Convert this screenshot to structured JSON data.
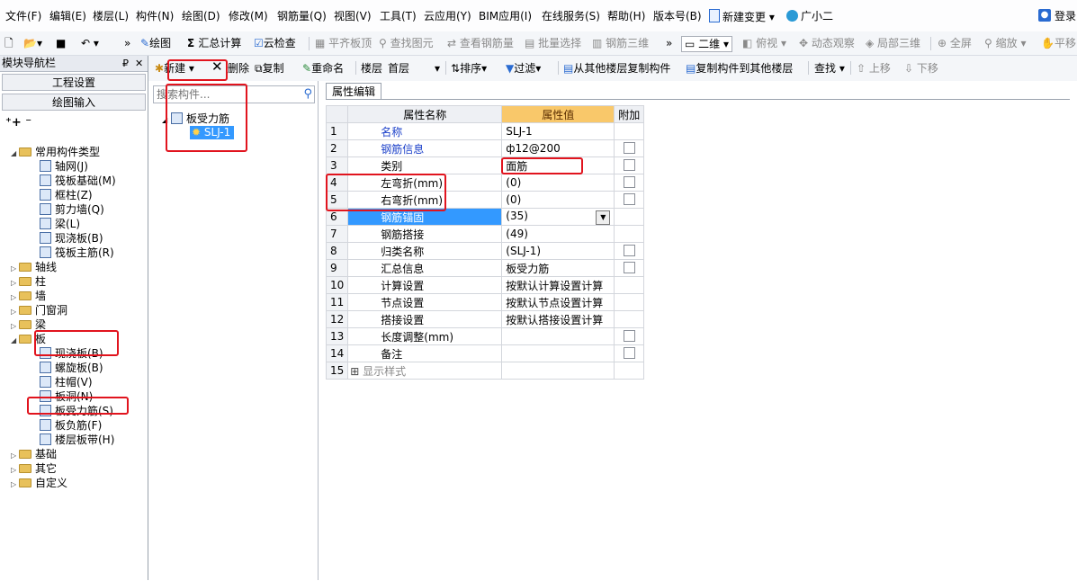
{
  "menu": [
    "文件(F)",
    "编辑(E)",
    "楼层(L)",
    "构件(N)",
    "绘图(D)",
    "修改(M)",
    "钢筋量(Q)",
    "视图(V)",
    "工具(T)",
    "云应用(Y)",
    "BIM应用(I)",
    "在线服务(S)",
    "帮助(H)",
    "版本号(B)",
    "新建变更",
    "广小二"
  ],
  "login_label": "登录",
  "toolbar1": {
    "draw": "绘图",
    "sum": "汇总计算",
    "cloud_check": "云检查",
    "flat_top": "平齐板顶",
    "find_elem": "查找图元",
    "view_rebar": "查看钢筋量",
    "batch_select": "批量选择",
    "rebar_3d": "钢筋三维",
    "view_mode": "二维",
    "top_view": "俯视",
    "dynamic": "动态观察",
    "partial_3d": "局部三维",
    "fullscreen": "全屏",
    "zoom": "缩放",
    "pan": "平移"
  },
  "nav": {
    "title": "模块导航栏",
    "btn_project": "工程设置",
    "btn_draw": "绘图输入",
    "tree": [
      {
        "label": "常用构件类型",
        "type": "folder-open"
      },
      {
        "label": "轴网(J)",
        "type": "child"
      },
      {
        "label": "筏板基础(M)",
        "type": "child"
      },
      {
        "label": "框柱(Z)",
        "type": "child"
      },
      {
        "label": "剪力墙(Q)",
        "type": "child"
      },
      {
        "label": "梁(L)",
        "type": "child"
      },
      {
        "label": "现浇板(B)",
        "type": "child"
      },
      {
        "label": "筏板主筋(R)",
        "type": "child"
      },
      {
        "label": "轴线",
        "type": "folder"
      },
      {
        "label": "柱",
        "type": "folder"
      },
      {
        "label": "墙",
        "type": "folder"
      },
      {
        "label": "门窗洞",
        "type": "folder"
      },
      {
        "label": "梁",
        "type": "folder"
      },
      {
        "label": "板",
        "type": "folder-open"
      },
      {
        "label": "现浇板(B)",
        "type": "child"
      },
      {
        "label": "螺旋板(B)",
        "type": "child"
      },
      {
        "label": "柱帽(V)",
        "type": "child"
      },
      {
        "label": "板洞(N)",
        "type": "child"
      },
      {
        "label": "板受力筋(S)",
        "type": "child"
      },
      {
        "label": "板负筋(F)",
        "type": "child"
      },
      {
        "label": "楼层板带(H)",
        "type": "child"
      },
      {
        "label": "基础",
        "type": "folder"
      },
      {
        "label": "其它",
        "type": "folder"
      },
      {
        "label": "自定义",
        "type": "folder"
      }
    ]
  },
  "toolbar2": {
    "new": "新建",
    "delete": "删除",
    "copy": "复制",
    "rename": "重命名",
    "floor_label": "楼层",
    "floor_value": "首层",
    "sort": "排序",
    "filter": "过滤",
    "copy_from": "从其他楼层复制构件",
    "copy_to": "复制构件到其他楼层",
    "find": "查找",
    "up": "上移",
    "down": "下移"
  },
  "middle": {
    "search_placeholder": "搜索构件...",
    "root": "板受力筋",
    "child": "SLJ-1"
  },
  "props": {
    "tab": "属性编辑",
    "col_name": "属性名称",
    "col_value": "属性值",
    "col_add": "附加",
    "rows": [
      {
        "n": "1",
        "name": "名称",
        "value": "SLJ-1"
      },
      {
        "n": "2",
        "name": "钢筋信息",
        "value": "ф12@200"
      },
      {
        "n": "3",
        "name": "类别",
        "value": "面筋"
      },
      {
        "n": "4",
        "name": "左弯折(mm)",
        "value": "(0)"
      },
      {
        "n": "5",
        "name": "右弯折(mm)",
        "value": "(0)"
      },
      {
        "n": "6",
        "name": "钢筋锚固",
        "value": "(35)"
      },
      {
        "n": "7",
        "name": "钢筋搭接",
        "value": "(49)"
      },
      {
        "n": "8",
        "name": "归类名称",
        "value": "(SLJ-1)"
      },
      {
        "n": "9",
        "name": "汇总信息",
        "value": "板受力筋"
      },
      {
        "n": "10",
        "name": "计算设置",
        "value": "按默认计算设置计算"
      },
      {
        "n": "11",
        "name": "节点设置",
        "value": "按默认节点设置计算"
      },
      {
        "n": "12",
        "name": "搭接设置",
        "value": "按默认搭接设置计算"
      },
      {
        "n": "13",
        "name": "长度调整(mm)",
        "value": ""
      },
      {
        "n": "14",
        "name": "备注",
        "value": ""
      },
      {
        "n": "15",
        "name": "显示样式",
        "value": ""
      }
    ]
  },
  "colors": {
    "accent": "#3399ff",
    "highlight": "#e1141e",
    "header_value": "#f9c86a",
    "link": "#1a3fc9"
  }
}
